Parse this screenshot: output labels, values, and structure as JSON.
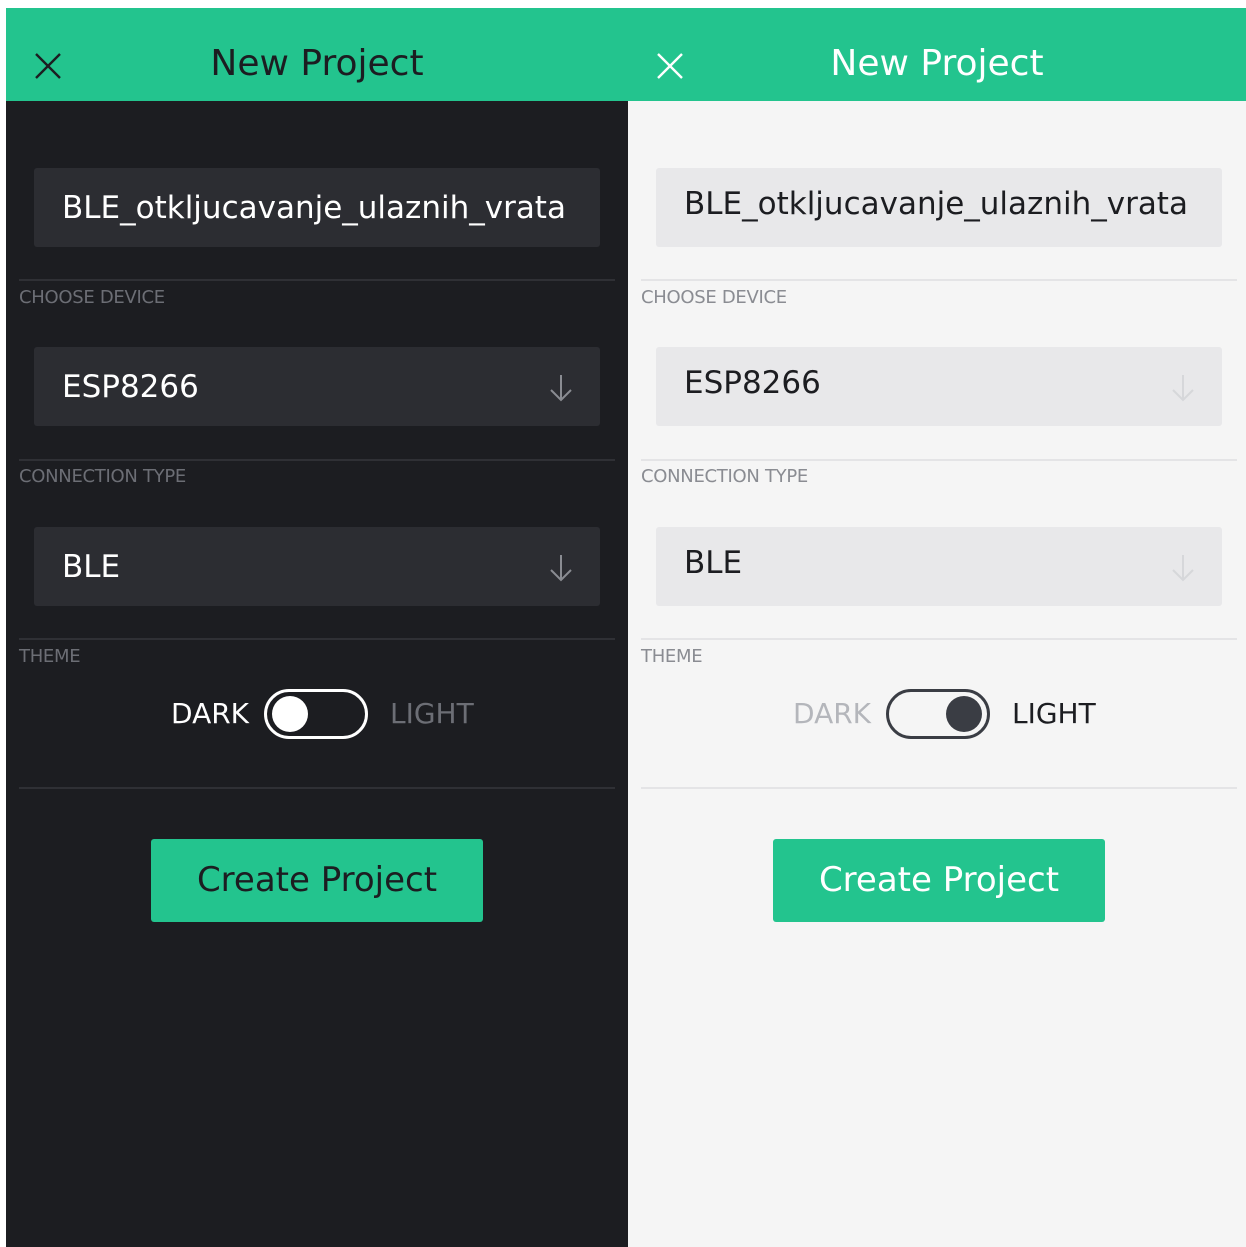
{
  "colors": {
    "accent": "#23c48e",
    "dark_background": "#1c1d21",
    "light_background": "#f5f5f5"
  },
  "screens": [
    {
      "theme": "dark",
      "header": {
        "title": "New Project",
        "close_icon": "close-icon"
      },
      "project_name": {
        "value": "BLE_otkljucavanje_ulaznih_vrata"
      },
      "device": {
        "label": "CHOOSE DEVICE",
        "value": "ESP8266",
        "icon": "arrow-down-icon"
      },
      "connection": {
        "label": "CONNECTION TYPE",
        "value": "BLE",
        "icon": "arrow-down-icon"
      },
      "theme_section": {
        "label": "THEME",
        "dark_label": "DARK",
        "light_label": "LIGHT",
        "selected": "DARK"
      },
      "create_button": {
        "label": "Create Project"
      }
    },
    {
      "theme": "light",
      "header": {
        "title": "New Project",
        "close_icon": "close-icon"
      },
      "project_name": {
        "value": "BLE_otkljucavanje_ulaznih_vrata"
      },
      "device": {
        "label": "CHOOSE DEVICE",
        "value": "ESP8266",
        "icon": "arrow-down-icon"
      },
      "connection": {
        "label": "CONNECTION TYPE",
        "value": "BLE",
        "icon": "arrow-down-icon"
      },
      "theme_section": {
        "label": "THEME",
        "dark_label": "DARK",
        "light_label": "LIGHT",
        "selected": "LIGHT"
      },
      "create_button": {
        "label": "Create Project"
      }
    }
  ]
}
